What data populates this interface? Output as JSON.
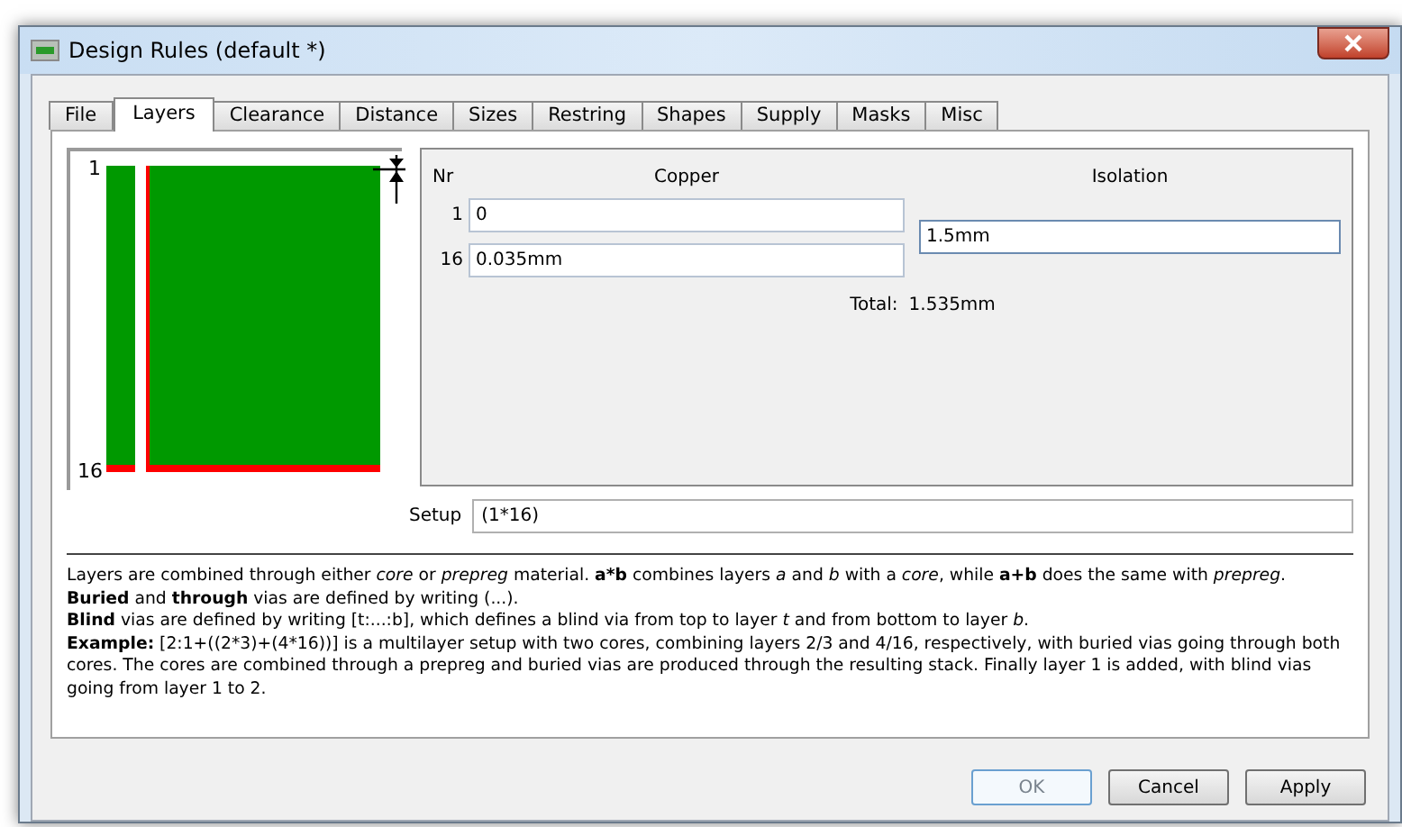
{
  "window": {
    "title": "Design Rules (default *)"
  },
  "tabs": [
    {
      "label": "File",
      "selected": false
    },
    {
      "label": "Layers",
      "selected": true
    },
    {
      "label": "Clearance",
      "selected": false
    },
    {
      "label": "Distance",
      "selected": false
    },
    {
      "label": "Sizes",
      "selected": false
    },
    {
      "label": "Restring",
      "selected": false
    },
    {
      "label": "Shapes",
      "selected": false
    },
    {
      "label": "Supply",
      "selected": false
    },
    {
      "label": "Masks",
      "selected": false
    },
    {
      "label": "Misc",
      "selected": false
    }
  ],
  "diagram": {
    "top_label": "1",
    "bottom_label": "16"
  },
  "layers": {
    "nr_header": "Nr",
    "copper_header": "Copper",
    "isolation_header": "Isolation",
    "rows": [
      {
        "nr": "1",
        "copper": "0"
      },
      {
        "nr": "16",
        "copper": "0.035mm"
      }
    ],
    "isolation": "1.5mm",
    "total_label": "Total:",
    "total": "1.535mm"
  },
  "setup": {
    "label": "Setup",
    "value": "(1*16)"
  },
  "help": [
    "Layers are combined through either *core* or *prepreg* material. **a*b** combines layers *a* and *b* with a *core*, while **a+b** does the same with *prepreg*.",
    "**Buried** and **through** vias are defined by writing (...).",
    "**Blind** vias are defined by writing [t:...:b], which defines a blind via from top to layer *t* and from bottom to layer *b*.",
    "**Example:** [2:1+((2*3)+(4*16))] is a multilayer setup with two cores, combining layers 2/3 and 4/16, respectively, with buried vias going through both cores. The cores are combined through a prepreg and buried vias are produced through the resulting stack. Finally layer 1 is added, with blind vias going from layer 1 to 2."
  ],
  "buttons": [
    {
      "label": "OK",
      "default": true
    },
    {
      "label": "Cancel",
      "default": false
    },
    {
      "label": "Apply",
      "default": false
    }
  ]
}
